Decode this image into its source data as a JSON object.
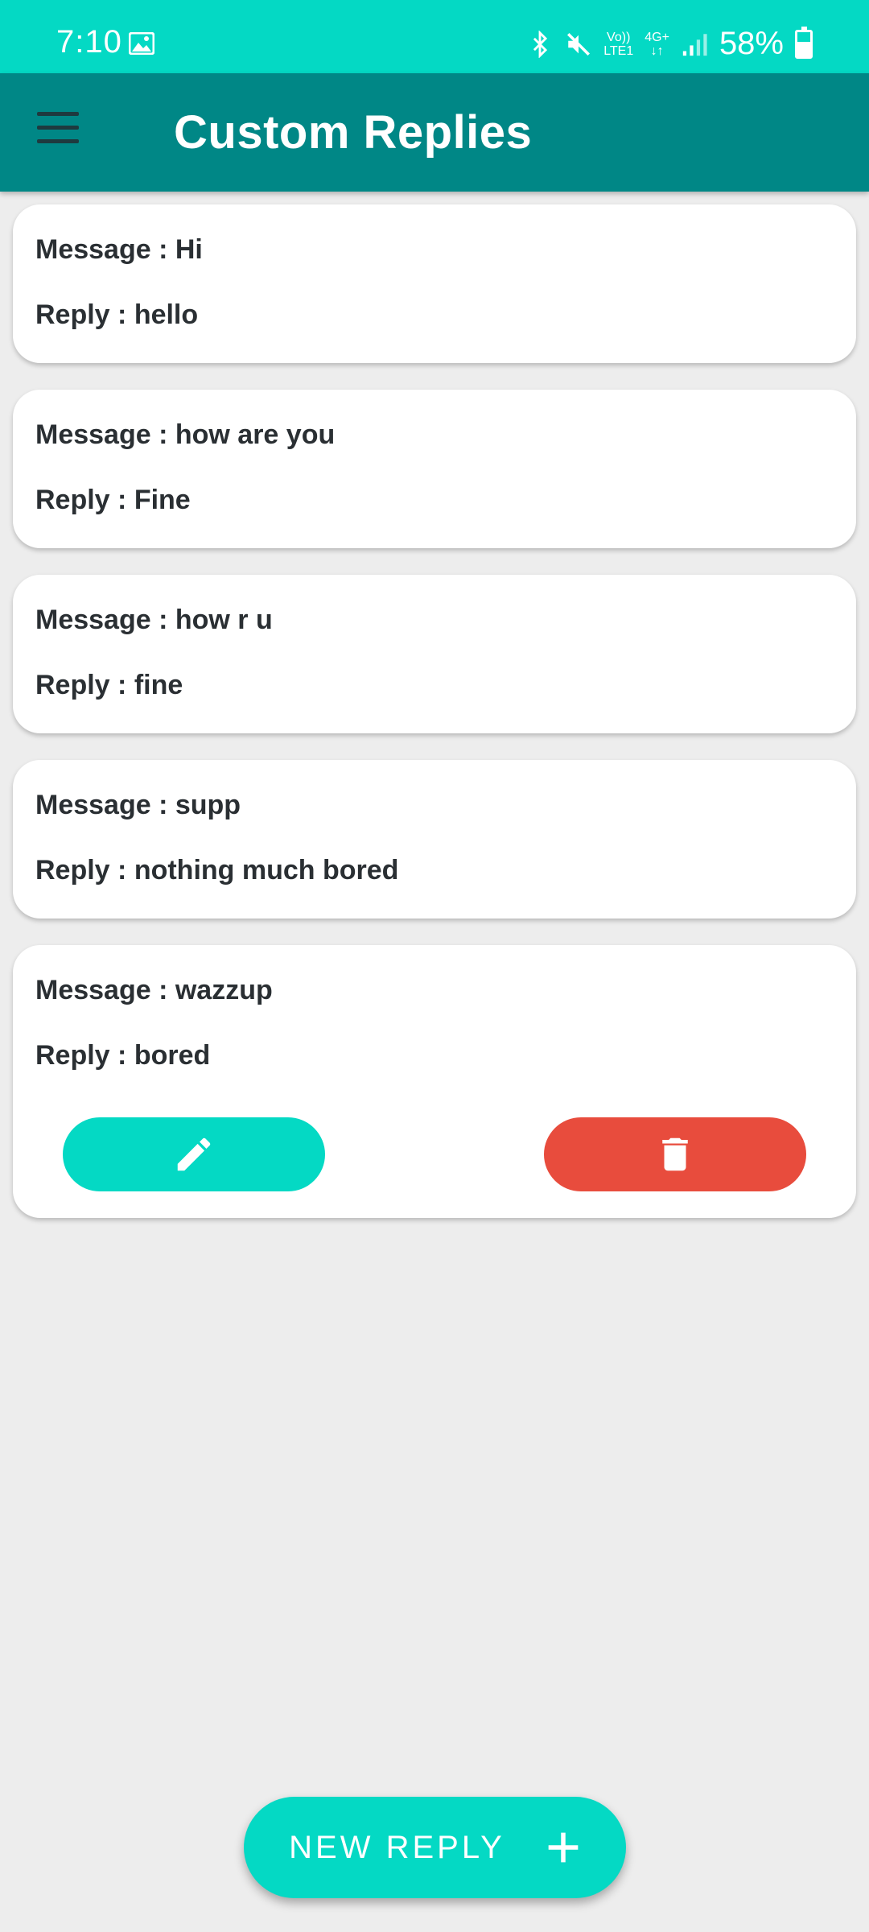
{
  "status_bar": {
    "time": "7:10",
    "volte_top": "Vo))",
    "volte_bottom": "LTE1",
    "network_top": "4G+",
    "network_bottom": "↓↑",
    "battery_percent": "58%",
    "battery_level": 58,
    "icons": [
      "gallery-icon",
      "bluetooth-icon",
      "mute-icon",
      "signal-icon",
      "battery-icon"
    ]
  },
  "app_bar": {
    "title": "Custom Replies",
    "menu_icon": "hamburger-menu-icon",
    "background": "#008786"
  },
  "colors": {
    "accent": "#04d9c4",
    "delete": "#e84c3d",
    "text": "#2a2f33"
  },
  "replies": [
    {
      "message_label": "Message : ",
      "message": "Hi",
      "reply_label": "Reply : ",
      "reply": "hello"
    },
    {
      "message_label": "Message : ",
      "message": "how are you",
      "reply_label": "Reply : ",
      "reply": "Fine"
    },
    {
      "message_label": "Message : ",
      "message": "how r u",
      "reply_label": "Reply : ",
      "reply": "fine"
    },
    {
      "message_label": "Message : ",
      "message": "supp",
      "reply_label": "Reply : ",
      "reply": "nothing much bored"
    },
    {
      "message_label": "Message : ",
      "message": "wazzup",
      "reply_label": "Reply : ",
      "reply": "bored"
    }
  ],
  "actions": {
    "edit_icon": "pencil-icon",
    "delete_icon": "trash-icon"
  },
  "fab": {
    "label": "NEW REPLY",
    "icon": "plus-icon"
  }
}
